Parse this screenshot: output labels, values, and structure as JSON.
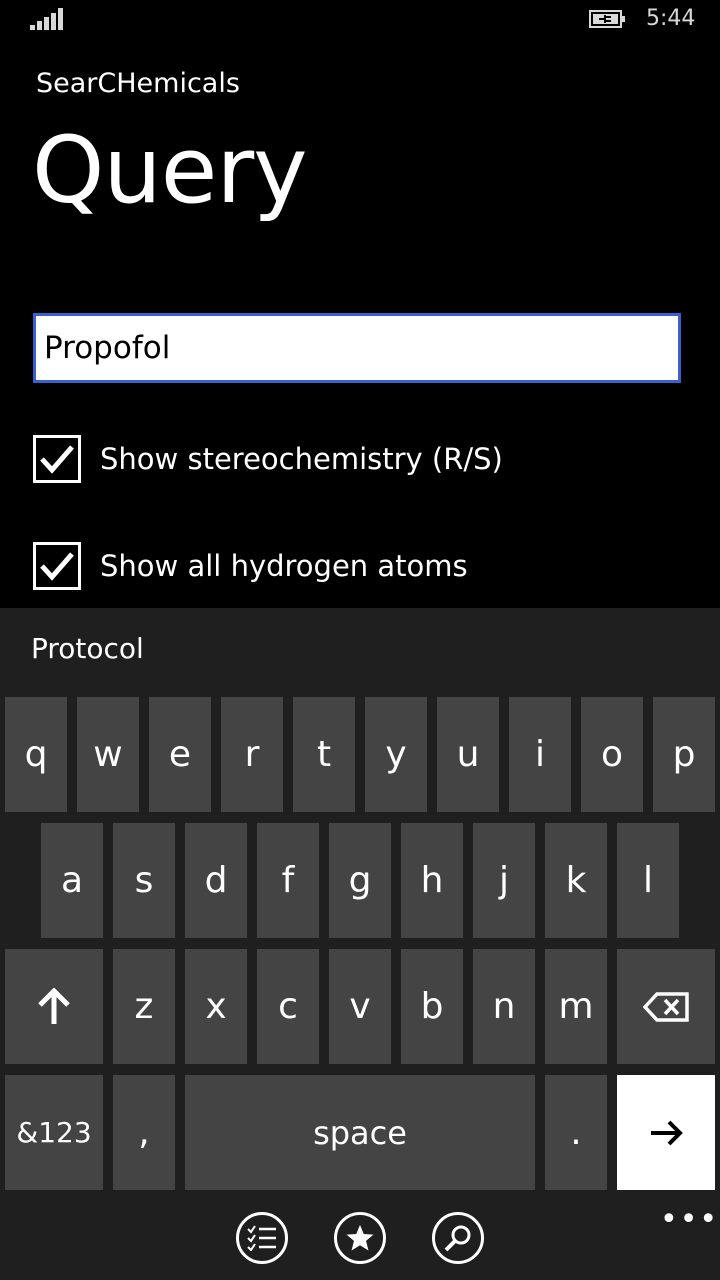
{
  "status": {
    "time": "5:44"
  },
  "app": {
    "name": "SearCHemicals",
    "page_title": "Query"
  },
  "search": {
    "value": "Propofol"
  },
  "options": [
    {
      "label": "Show stereochemistry (R/S)",
      "checked": true
    },
    {
      "label": "Show all hydrogen atoms",
      "checked": true
    }
  ],
  "suggestion": "Protocol",
  "keyboard": {
    "row1": [
      "q",
      "w",
      "e",
      "r",
      "t",
      "y",
      "u",
      "i",
      "o",
      "p"
    ],
    "row2": [
      "a",
      "s",
      "d",
      "f",
      "g",
      "h",
      "j",
      "k",
      "l"
    ],
    "row3": [
      "z",
      "x",
      "c",
      "v",
      "b",
      "n",
      "m"
    ],
    "numbers_label": "&123",
    "comma": ",",
    "space_label": "space",
    "period": "."
  },
  "app_bar": {
    "more": "•••"
  },
  "icons": {
    "signal": "signal-strength-icon",
    "battery": "battery-charging-icon",
    "shift": "shift-arrow-icon",
    "backspace": "backspace-icon",
    "enter": "enter-arrow-icon",
    "list": "list-icon",
    "favorite": "star-icon",
    "search": "search-icon"
  },
  "colors": {
    "accent": "#3a5fd0",
    "key": "#444444",
    "keyboard_bg": "#1f1f1f"
  }
}
